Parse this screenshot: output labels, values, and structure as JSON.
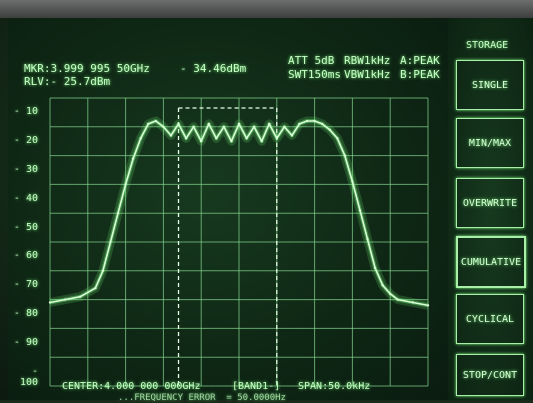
{
  "header": {
    "marker": "MKR:3.999 995 50GHz",
    "marker_level": "- 34.46dBm",
    "ref_level": "RLV:- 25.7dBm",
    "att": "ATT 5dB",
    "rbw": "RBW1kHz",
    "trace_a": "A:PEAK",
    "swt": "SWT150ms",
    "vbw": "VBW1kHz",
    "trace_b": "B:PEAK"
  },
  "footer": {
    "center": "CENTER:4.000 000 000GHz",
    "band": "[BAND1-]",
    "span": "SPAN:50.0kHz",
    "secondary": "...FREQUENCY ERROR  = 50.0000Hz"
  },
  "y_ticks": [
    "10",
    "20",
    "30",
    "40",
    "50",
    "60",
    "70",
    "80",
    "90",
    "100"
  ],
  "softkeys": {
    "title": "STORAGE",
    "items": [
      "SINGLE",
      "MIN/MAX",
      "OVERWRITE",
      "CUMULATIVE",
      "CYCLICAL",
      "STOP/CONT"
    ]
  },
  "chart_data": {
    "type": "line",
    "ylim": [
      -100,
      0
    ],
    "x": [
      0,
      4,
      8,
      12,
      14,
      16,
      18,
      20,
      22,
      24,
      26,
      28,
      30,
      32,
      34,
      36,
      38,
      40,
      42,
      44,
      46,
      48,
      50,
      52,
      54,
      56,
      58,
      60,
      62,
      64,
      66,
      68,
      70,
      72,
      74,
      76,
      78,
      80,
      82,
      84,
      86,
      88,
      90,
      92,
      96,
      100
    ],
    "series": [
      {
        "values": [
          -71,
          -70,
          -69,
          -66,
          -60,
          -50,
          -40,
          -30,
          -21,
          -14,
          -9,
          -8,
          -10,
          -13,
          -9,
          -14,
          -10,
          -15,
          -9,
          -14,
          -10,
          -15,
          -9,
          -14,
          -10,
          -15,
          -9,
          -14,
          -10,
          -13,
          -9,
          -8,
          -8,
          -9,
          -11,
          -14,
          -20,
          -29,
          -39,
          -49,
          -59,
          -65,
          -68,
          -70,
          -71,
          -72
        ]
      }
    ],
    "markers": {
      "dashed_left_x": 34,
      "dashed_right_x": 60
    }
  },
  "colors": {
    "trace": "#d8ffd8",
    "grid": "#7fcf8a",
    "glow": "#7fff7f"
  }
}
